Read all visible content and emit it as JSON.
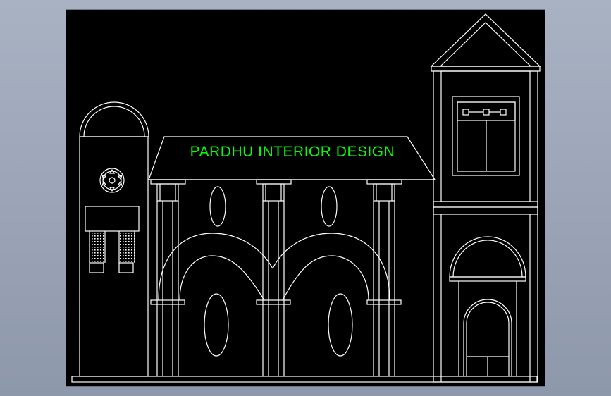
{
  "window": {
    "background": "#000000",
    "frame_color": "#9aa3b5"
  },
  "drawing": {
    "line_color": "#ffffff",
    "signboard": {
      "text": "PARDHU INTERIOR DESIGN",
      "color": "#00ff00"
    }
  }
}
